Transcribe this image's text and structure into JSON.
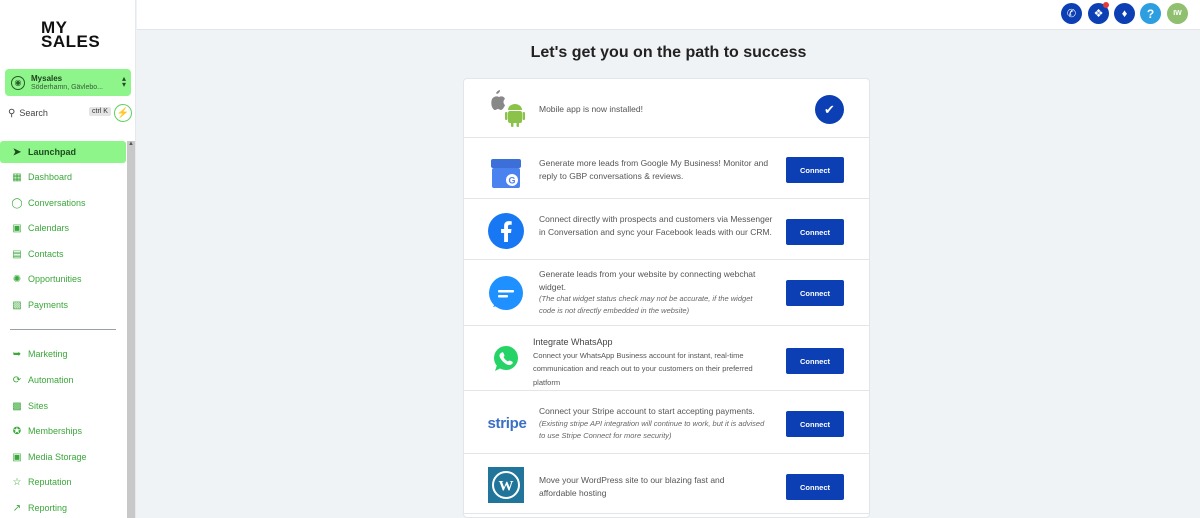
{
  "brand": {
    "line1": "MY",
    "line2": "SALES"
  },
  "account": {
    "name": "Mysales",
    "location": "Söderhamn, Gävlebo..."
  },
  "search": {
    "label": "Search",
    "shortcut": "ctrl K"
  },
  "nav": [
    {
      "label": "Launchpad",
      "icon": "rocket-icon",
      "active": true
    },
    {
      "label": "Dashboard",
      "icon": "grid-icon"
    },
    {
      "label": "Conversations",
      "icon": "chat-icon"
    },
    {
      "label": "Calendars",
      "icon": "calendar-icon"
    },
    {
      "label": "Contacts",
      "icon": "contacts-icon"
    },
    {
      "label": "Opportunities",
      "icon": "opportunities-icon"
    },
    {
      "label": "Payments",
      "icon": "payments-icon"
    },
    {
      "label": "Marketing",
      "icon": "send-icon"
    },
    {
      "label": "Automation",
      "icon": "automation-icon"
    },
    {
      "label": "Sites",
      "icon": "sites-icon"
    },
    {
      "label": "Memberships",
      "icon": "badge-icon"
    },
    {
      "label": "Media Storage",
      "icon": "image-icon"
    },
    {
      "label": "Reputation",
      "icon": "star-icon"
    },
    {
      "label": "Reporting",
      "icon": "trend-icon"
    }
  ],
  "topbar": {
    "user_initials": "IW",
    "help": "?"
  },
  "main": {
    "heading": "Let's get you on the path to success",
    "rows": [
      {
        "icon": "mobile-app-icon",
        "text": "Mobile app is now installed!",
        "status": "done"
      },
      {
        "icon": "google-business-icon",
        "text": "Generate more leads from Google My Business! Monitor and reply to GBP conversations & reviews.",
        "button": "Connect"
      },
      {
        "icon": "facebook-icon",
        "text": "Connect directly with prospects and customers via Messenger in Conversation and sync your Facebook leads with our CRM.",
        "button": "Connect"
      },
      {
        "icon": "webchat-icon",
        "text": "Generate leads from your website by connecting webchat widget.",
        "note": "(The chat widget status check may not be accurate, if the widget code is not directly embedded in the website)",
        "button": "Connect"
      },
      {
        "icon": "whatsapp-icon",
        "title": "Integrate WhatsApp",
        "text": "Connect your WhatsApp Business account for instant, real-time communication and reach out to your customers on their preferred platform",
        "button": "Connect"
      },
      {
        "icon": "stripe-icon",
        "logo_text": "stripe",
        "text": "Connect your Stripe account to start accepting payments.",
        "note": "(Existing stripe API integration will continue to work, but it is advised to use Stripe Connect for more security)",
        "button": "Connect"
      },
      {
        "icon": "wordpress-icon",
        "text": "Move your WordPress site to our blazing fast and affordable hosting",
        "button": "Connect"
      }
    ]
  },
  "colors": {
    "accent_green": "#8df58a",
    "nav_green": "#3aa83a",
    "primary_blue": "#0b3fb3",
    "help_blue": "#2d9ee0",
    "facebook_blue": "#1877f2",
    "whatsapp_green": "#25d366",
    "stripe_blue": "#3a6fc4",
    "wordpress_blue": "#21759b"
  }
}
